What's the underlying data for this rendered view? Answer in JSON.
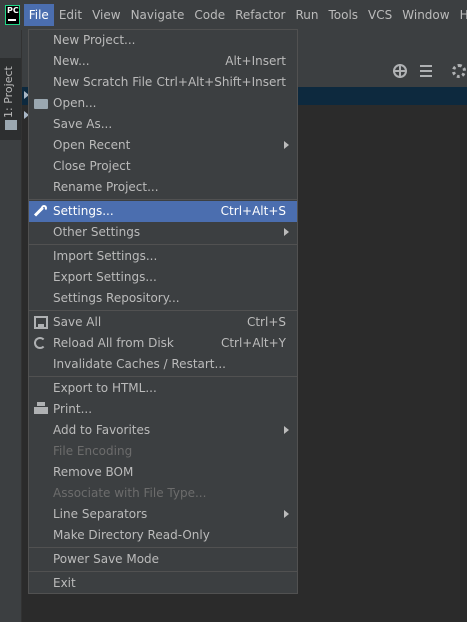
{
  "app": {
    "logo_text": "PC"
  },
  "menubar": {
    "items": [
      "File",
      "Edit",
      "View",
      "Navigate",
      "Code",
      "Refactor",
      "Run",
      "Tools",
      "VCS",
      "Window",
      "He"
    ],
    "active": "File"
  },
  "sidebar": {
    "project_tab_label": "1: Project"
  },
  "colors": {
    "accent": "#4b6eaf",
    "menu_bg": "#3c3f41",
    "editor_bg": "#2b2b2b"
  },
  "file_menu": {
    "new_project": "New Project...",
    "new": "New...",
    "new_shortcut": "Alt+Insert",
    "new_scratch": "New Scratch File",
    "new_scratch_shortcut": "Ctrl+Alt+Shift+Insert",
    "open": "Open...",
    "save_as": "Save As...",
    "open_recent": "Open Recent",
    "close_project": "Close Project",
    "rename_project": "Rename Project...",
    "settings": "Settings...",
    "settings_shortcut": "Ctrl+Alt+S",
    "other_settings": "Other Settings",
    "import_settings": "Import Settings...",
    "export_settings": "Export Settings...",
    "settings_repository": "Settings Repository...",
    "save_all": "Save All",
    "save_all_shortcut": "Ctrl+S",
    "reload_all": "Reload All from Disk",
    "reload_all_shortcut": "Ctrl+Alt+Y",
    "invalidate_caches": "Invalidate Caches / Restart...",
    "export_html": "Export to HTML...",
    "print": "Print...",
    "add_favorites": "Add to Favorites",
    "file_encoding": "File Encoding",
    "remove_bom": "Remove BOM",
    "associate_file_type": "Associate with File Type...",
    "line_separators": "Line Separators",
    "make_readonly": "Make Directory Read-Only",
    "power_save": "Power Save Mode",
    "exit": "Exit"
  }
}
